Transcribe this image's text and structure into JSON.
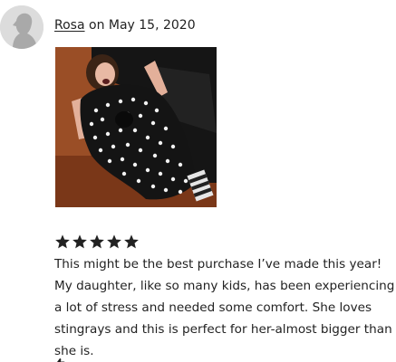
{
  "review": {
    "author": "Rosa",
    "date_text": " on May 15, 2020",
    "rating": 5,
    "rating_max": 5,
    "text": "This might be the best purchase I’ve made this year! My daughter, like so many kids, has been experiencing a lot of stress and needed some comfort. She loves stingrays and this is perfect for her-almost bigger than she is."
  },
  "icons": {
    "avatar": "default-user-avatar-icon",
    "star": "star-filled-icon",
    "helpful": "thumbs-up-icon"
  },
  "colors": {
    "text": "#222222",
    "star": "#222222",
    "avatar_bg": "#dcdcdc",
    "avatar_fg": "#a9a9a9"
  }
}
